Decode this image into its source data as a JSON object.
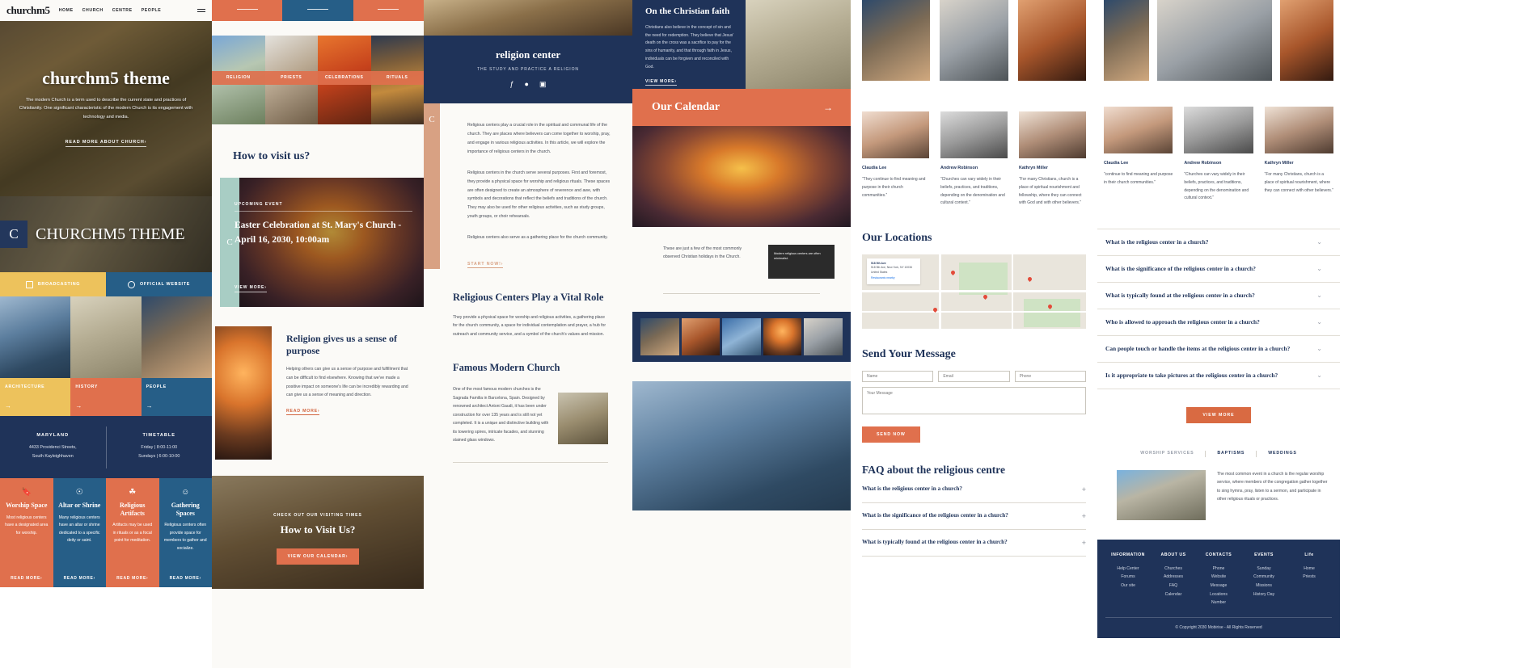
{
  "col1": {
    "logo": "churchm5",
    "nav": [
      "HOME",
      "CHURCH",
      "CENTRE",
      "PEOPLE"
    ],
    "hero": {
      "title": "churchm5 theme",
      "subtitle": "The modern Church is a term used to describe the current state and practices of Christianity. One significant characteristic of the modern Church is its engagement with technology and media.",
      "cta": "READ MORE ABOUT CHURCH›"
    },
    "band": {
      "badge": "C",
      "title": "CHURCHM5 THEME"
    },
    "buttons": [
      {
        "label": "BROADCASTING",
        "icon": "video-icon"
      },
      {
        "label": "OFFICIAL WEBSITE",
        "icon": "globe-icon"
      }
    ],
    "categories": [
      "ARCHITECTURE",
      "HISTORY",
      "PEOPLE"
    ],
    "info": [
      {
        "heading": "MARYLAND",
        "lines": "4433 Providenci Streets,\nSouth Kayleighhaven"
      },
      {
        "heading": "TIMETABLE",
        "lines": "Friday | 8:00-11:00\nSundays | 6:00-10:00"
      }
    ],
    "features": [
      {
        "icon": "bookmark-icon",
        "title": "Worship Space",
        "text": "Most religious centers have a designated area for worship.",
        "more": "READ MORE›"
      },
      {
        "icon": "user-circle-icon",
        "title": "Altar or Shrine",
        "text": "Many religious centers have an altar or shrine dedicated to a specific deity or saint.",
        "more": "READ MORE›"
      },
      {
        "icon": "globe-icon",
        "title": "Religious Artifacts",
        "text": "Artifacts may be used in rituals or as a focal point for meditation.",
        "more": "READ MORE›"
      },
      {
        "icon": "people-icon",
        "title": "Gathering Spaces",
        "text": "Religious centers often provide space for members to gather and socialize.",
        "more": "READ MORE›"
      }
    ]
  },
  "col2": {
    "gallery_labels": [
      "RELIGION",
      "PRIESTS",
      "CELEBRATIONS",
      "RITUALS"
    ],
    "heading": "How to visit us?",
    "event": {
      "badge": "C",
      "kicker": "UPCOMING EVENT",
      "title": "Easter Celebration at St. Mary's Church -",
      "date": "April 16, 2030, 10:00am",
      "cta": "VIEW MORE›"
    },
    "split": {
      "title": "Religion gives us a sense of purpose",
      "text": "Helping others can give us a sense of purpose and fulfillment that can be difficult to find elsewhere. Knowing that we've made a positive impact on someone's life can be incredibly rewarding and can give us a sense of meaning and direction.",
      "link": "READ MORE›"
    },
    "bottom": {
      "kicker": "CHECK OUT OUR VISITING TIMES",
      "title": "How to Visit Us?",
      "button": "VIEW OUR CALENDAR›"
    }
  },
  "col3": {
    "hero": {
      "title": "religion center",
      "subtitle": "THE STUDY AND PRACTICE A RELIGION",
      "social": [
        "facebook-icon",
        "twitter-icon",
        "instagram-icon"
      ]
    },
    "badge": "C",
    "paragraphs": [
      "Religious centers play a crucial role in the spiritual and communal life of the church. They are places where believers can come together to worship, pray, and engage in various religious activities. In this article, we will explore the importance of religious centers in the church.",
      "Religious centers in the church serve several purposes. First and foremost, they provide a physical space for worship and religious rituals. These spaces are often designed to create an atmosphere of reverence and awe, with symbols and decorations that reflect the beliefs and traditions of the church. They may also be used for other religious activities, such as study groups, youth groups, or choir rehearsals.",
      "Religious centers also serve as a gathering place for the church community."
    ],
    "link": "START NOW!›",
    "section1": {
      "title": "Religious Centers Play a Vital Role",
      "text": "They provide a physical space for worship and religious activities, a gathering place for the church community, a space for individual contemplation and prayer, a hub for outreach and community service, and a symbol of the church's values and mission."
    },
    "section2": {
      "title": "Famous Modern Church",
      "text": "One of the most famous modern churches is the Sagrada Familia in Barcelona, Spain. Designed by renowned architect Antoni Gaudi, it has been under construction for over 135 years and is still not yet completed. It is a unique and distinctive building with its towering spires, intricate facades, and stunning stained glass windows."
    }
  },
  "col4": {
    "faith": {
      "title": "On the Christian faith",
      "text": "Christians also believe in the concept of sin and the need for redemption. They believe that Jesus' death on the cross was a sacrifice to pay for the sins of humanity, and that through faith in Jesus, individuals can be forgiven and reconciled with God.",
      "link": "VIEW MORE›"
    },
    "calendar": {
      "title": "Our Calendar",
      "arrow": "arrow-right-icon"
    },
    "mid_text": "These are just a few of the most commonly observed Christian holidays in the Church.",
    "card_text": "Modern religious centers are often minimalist."
  },
  "col5": {
    "testimonials": [
      {
        "name": "Claudia Lee",
        "quote": "“They continue to find meaning and purpose in their church communities.”"
      },
      {
        "name": "Andrew Robinson",
        "quote": "“Churches can vary widely in their beliefs, practices, and traditions, depending on the denomination and cultural context.”"
      },
      {
        "name": "Kathryn Miller",
        "quote": "“For many Christians, church is a place of spiritual nourishment and fellowship, where they can connect with God and with other believers.”"
      }
    ],
    "locations_heading": "Our Locations",
    "map_card": {
      "title": "518 5th Ave",
      "lines": "518 5th Ave, New York, NY 10036\nUnited States",
      "link": "Restaurants nearby"
    },
    "form": {
      "heading": "Send Your Message",
      "fields": [
        {
          "name": "name-field",
          "placeholder": "Name"
        },
        {
          "name": "email-field",
          "placeholder": "Email"
        },
        {
          "name": "phone-field",
          "placeholder": "Phone"
        }
      ],
      "message_placeholder": "Your Message",
      "submit": "SEND NOW"
    },
    "faq_heading": "FAQ about the religious centre",
    "faq": [
      "What is the religious center in a church?",
      "What is the significance of the religious center in a church?",
      "What is typically found at the religious center in a church?"
    ],
    "faq_plus": "+"
  },
  "col6": {
    "top_faq": [
      "Who is allowed to approach the religious center in a church?",
      "Can people touch or handle the items at the religious center in a church?",
      "Is it appropriate to take pictures at the religious center in a church?"
    ],
    "faq_plus": "+",
    "testimonials": [
      {
        "name": "Claudia Lee",
        "quote": "“continue to find meaning and purpose in their church communities.”"
      },
      {
        "name": "Andrew Robinson",
        "quote": "“Churches can vary widely in their beliefs, practices, and traditions, depending on the denomination and cultural context.”"
      },
      {
        "name": "Kathryn Miller",
        "quote": "“For many Christians, church is a place of spiritual nourishment, where they can connect with other believers.”"
      }
    ],
    "accordion": [
      "What is the religious center in a church?",
      "What is the significance of the religious center in a church?",
      "What is typically found at the religious center in a church?",
      "Who is allowed to approach the religious center in a church?",
      "Can people touch or handle the items at the religious center in a church?",
      "Is it appropriate to take pictures at the religious center in a church?"
    ],
    "view_more": "VIEW MORE",
    "tabs": [
      {
        "label": "WORSHIP SERVICES",
        "active": false
      },
      {
        "label": "BAPTISMS",
        "active": true
      },
      {
        "label": "WEDDINGS",
        "active": true
      }
    ],
    "event_text": "The most common event in a church is the regular worship service, where members of the congregation gather together to sing hymns, pray, listen to a sermon, and participate in other religious rituals or practices.",
    "footer": {
      "columns": [
        {
          "heading": "INFORMATION",
          "links": [
            "Help Center",
            "Forums",
            "Our site"
          ]
        },
        {
          "heading": "ABOUT US",
          "links": [
            "Churches",
            "Addresses",
            "FAQ",
            "Calendar"
          ]
        },
        {
          "heading": "CONTACTS",
          "links": [
            "Phone",
            "Website",
            "Message",
            "Locations",
            "Number"
          ]
        },
        {
          "heading": "EVENTS",
          "links": [
            "Sunday",
            "Community",
            "Missions",
            "History Day"
          ]
        },
        {
          "heading": "Life",
          "links": [
            "Home",
            "Priests"
          ]
        }
      ],
      "copyright": "© Copyright 2030 Mobirise - All Rights Reserved"
    }
  },
  "colors": {
    "navy": "#1f3359",
    "orange": "#e0704d",
    "yellow": "#edc25c",
    "blue": "#265e87",
    "mint": "#a8cdc4",
    "tan": "#d8a183"
  }
}
